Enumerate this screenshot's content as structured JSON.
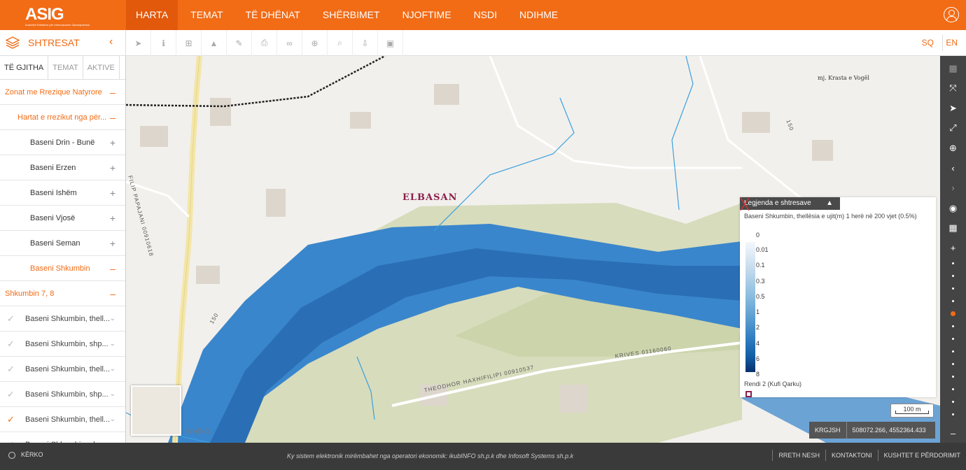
{
  "header": {
    "logo": "ASIG",
    "logo_sub": "Autoriteti Shtetëror për Informacionin Gjeohapësinor",
    "nav": [
      "HARTA",
      "TEMAT",
      "TË DHËNAT",
      "SHËRBIMET",
      "NJOFTIME",
      "NSDI",
      "NDIHME"
    ],
    "active_nav": "HARTA",
    "user_icon": "user-circle-icon"
  },
  "toolbar": {
    "layers_title": "SHTRESAT",
    "collapse": "‹",
    "tools": [
      "pointer-icon",
      "info-icon",
      "add-icon",
      "profile-icon",
      "edit-icon",
      "print-icon",
      "link-icon",
      "plus-circle-icon",
      "search-icon",
      "download-icon",
      "image-icon"
    ],
    "lang_sq": "SQ",
    "lang_en": "EN"
  },
  "sidebar": {
    "tabs": [
      "TË GJITHA",
      "TEMAT",
      "AKTIVE"
    ],
    "rows": [
      {
        "type": "cat",
        "label": "Zonat me Rrezique Natyrore",
        "sign": "–"
      },
      {
        "type": "sub",
        "label": "Hartat e rrezikut nga për...",
        "sign": "–"
      },
      {
        "type": "basin",
        "label": "Baseni Drin - Bunë",
        "sign": "+"
      },
      {
        "type": "basin",
        "label": "Baseni Erzen",
        "sign": "+"
      },
      {
        "type": "basin",
        "label": "Baseni Ishëm",
        "sign": "+"
      },
      {
        "type": "basin",
        "label": "Baseni Vjosë",
        "sign": "+"
      },
      {
        "type": "basin",
        "label": "Baseni Seman",
        "sign": "+"
      },
      {
        "type": "basin-open",
        "label": "Baseni Shkumbin",
        "sign": "–"
      },
      {
        "type": "cat",
        "label": "Shkumbin 7, 8",
        "sign": "–"
      },
      {
        "type": "layer",
        "label": "Baseni Shkumbin, thell...",
        "checked": false
      },
      {
        "type": "layer",
        "label": "Baseni Shkumbin, shp...",
        "checked": false
      },
      {
        "type": "layer",
        "label": "Baseni Shkumbin, thell...",
        "checked": false
      },
      {
        "type": "layer",
        "label": "Baseni Shkumbin, shp...",
        "checked": false
      },
      {
        "type": "layer-on",
        "label": "Baseni Shkumbin, thell...",
        "checked": true
      },
      {
        "type": "layer",
        "label": "Baseni Shkumbin, shp...",
        "checked": false
      }
    ]
  },
  "map": {
    "city": "ELBASAN",
    "place": "mj. Krasta e Vogël",
    "streets": {
      "filip": "FILIP PAPAJANI 00910618",
      "theodhor": "THEODHOR HAXHIFILIPI 00910537",
      "krives": "KRIVES 01160060",
      "road150": "150",
      "road130": "150"
    },
    "copyright": "© ASIG",
    "scale": "100 m",
    "crs": "KRGJSH",
    "coordinates": "508072.266, 4552364.433",
    "water_color": "#2f7bbf",
    "flood_color": "#3a86cc"
  },
  "legend": {
    "header": "Legjenda e shtresave",
    "layer_title": "Baseni Shkumbin, thellësia e ujit(m) 1 herë në 200 vjet (0.5%)",
    "nodata": "0",
    "values": [
      "0.01",
      "0.1",
      "0.3",
      "0.5",
      "1",
      "2",
      "4",
      "6",
      "8"
    ],
    "border_title": "Rendi 2 (Kufi Qarku)"
  },
  "rightbar": {
    "buttons": [
      "map-icon",
      "fullscreen-icon",
      "locate-icon",
      "expand-icon",
      "zoom-search-icon",
      "back-icon",
      "forward-icon",
      "globe-icon",
      "grid-icon",
      "zoom-in-icon"
    ],
    "zoom_out": "–"
  },
  "footer": {
    "search": "KËRKO",
    "operator": "Ky sistem elektronik mirëmbahet nga operatori ekonomik: ikubINFO sh.p.k dhe Infosoft Systems sh.p.k",
    "links": [
      "RRETH NESH",
      "KONTAKTONI",
      "KUSHTET E PËRDORIMIT"
    ]
  }
}
